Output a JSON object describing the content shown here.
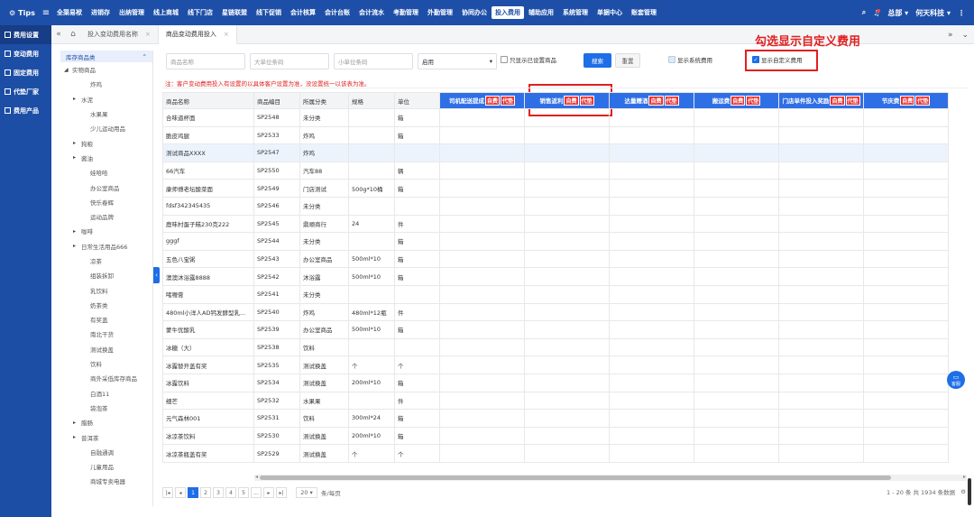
{
  "topbar": {
    "brand": "Tips",
    "items": [
      "全渠易袱",
      "进销存",
      "出纳管理",
      "线上商城",
      "线下门店",
      "星链联盟",
      "线下促销",
      "会计核算",
      "会计台账",
      "会计流水",
      "考勤管理",
      "外勤管理",
      "协同办公",
      "投入费用",
      "辅助应用",
      "系统管理",
      "单据中心",
      "账套管理"
    ],
    "active_index": 13,
    "user": "总部",
    "company": "何天科技"
  },
  "sidebar": {
    "items": [
      "费用设置",
      "变动费用",
      "固定费用",
      "代垫厂家",
      "费用产品"
    ],
    "active_index": 0
  },
  "tabs": {
    "items": [
      "投入变动费用名称",
      "商品变动费用投入"
    ],
    "active_index": 1
  },
  "tree": {
    "header": "库存商品类",
    "rows": [
      {
        "label": "实物商品",
        "indent": 0,
        "arrow": "◢"
      },
      {
        "label": "炸鸡",
        "indent": 2,
        "arrow": ""
      },
      {
        "label": "水泥",
        "indent": 1,
        "arrow": "▸"
      },
      {
        "label": "水果果",
        "indent": 2,
        "arrow": ""
      },
      {
        "label": "少儿运动用品",
        "indent": 2,
        "arrow": ""
      },
      {
        "label": "狗粮",
        "indent": 1,
        "arrow": "▸"
      },
      {
        "label": "酱油",
        "indent": 1,
        "arrow": "▸"
      },
      {
        "label": "娃哈哈",
        "indent": 2,
        "arrow": ""
      },
      {
        "label": "办公室商品",
        "indent": 2,
        "arrow": ""
      },
      {
        "label": "快乐春辉",
        "indent": 2,
        "arrow": ""
      },
      {
        "label": "运动品牌",
        "indent": 2,
        "arrow": ""
      },
      {
        "label": "咖啡",
        "indent": 1,
        "arrow": "▸"
      },
      {
        "label": "日常生活用品666",
        "indent": 1,
        "arrow": "▸"
      },
      {
        "label": "凉茶",
        "indent": 2,
        "arrow": ""
      },
      {
        "label": "组装拆卸",
        "indent": 2,
        "arrow": ""
      },
      {
        "label": "乳饮料",
        "indent": 2,
        "arrow": ""
      },
      {
        "label": "奶茶类",
        "indent": 2,
        "arrow": ""
      },
      {
        "label": "有奖盖",
        "indent": 2,
        "arrow": ""
      },
      {
        "label": "南北干货",
        "indent": 2,
        "arrow": ""
      },
      {
        "label": "测试换盖",
        "indent": 2,
        "arrow": ""
      },
      {
        "label": "饮料",
        "indent": 2,
        "arrow": ""
      },
      {
        "label": "商外采低库存商品",
        "indent": 2,
        "arrow": ""
      },
      {
        "label": "白酒11",
        "indent": 2,
        "arrow": ""
      },
      {
        "label": "袋泡茶",
        "indent": 2,
        "arrow": ""
      },
      {
        "label": "腊肠",
        "indent": 1,
        "arrow": "▸"
      },
      {
        "label": "普洱茶",
        "indent": 1,
        "arrow": "▸"
      },
      {
        "label": "自融通调",
        "indent": 2,
        "arrow": ""
      },
      {
        "label": "儿童用品",
        "indent": 2,
        "arrow": ""
      },
      {
        "label": "商城专卖电器",
        "indent": 2,
        "arrow": ""
      }
    ]
  },
  "filters": {
    "name_placeholder": "商品名称",
    "big_unit_placeholder": "大单位条码",
    "small_unit_placeholder": "小单位条码",
    "status_value": "启用",
    "only_set_label": "只显示已设置商品",
    "search_label": "搜索",
    "reset_label": "重置",
    "show_system_label": "显示系统费用",
    "show_custom_label": "显示自定义费用"
  },
  "annotation": "勾选显示自定义费用",
  "notice": "注：客户变动费用投入有设置的以具体客户设置为准，没设置统一以该表为准。",
  "table": {
    "columns": [
      "商品名称",
      "商品编目",
      "所属分类",
      "规格",
      "单位"
    ],
    "fee_columns": [
      "司机配送提成",
      "销售返利",
      "达量赠酒",
      "搬运费",
      "门店单件投入奖励",
      "节庆费"
    ],
    "tag_self": "自费",
    "tag_pay": "代垫",
    "rows": [
      [
        "合味道杯面",
        "SP2548",
        "未分类",
        "",
        "箱"
      ],
      [
        "脆皮鸡腿",
        "SP2533",
        "炸鸡",
        "",
        "箱"
      ],
      [
        "测试商品XXXX",
        "SP2547",
        "炸鸡",
        "",
        ""
      ],
      [
        "66汽车",
        "SP2550",
        "汽车88",
        "",
        "辆"
      ],
      [
        "康师傅老坛酸菜面",
        "SP2549",
        "门店测试",
        "500g*10桶",
        "箱"
      ],
      [
        "fdsf342345435",
        "SP2546",
        "未分类",
        "",
        ""
      ],
      [
        "鹿味村蛋子糕230克222",
        "SP2545",
        "鼎顺商行",
        "24",
        "件"
      ],
      [
        "gggf",
        "SP2544",
        "未分类",
        "",
        "箱"
      ],
      [
        "五色八宝粥",
        "SP2543",
        "办公室商品",
        "500ml*10",
        "箱"
      ],
      [
        "澳澳沐浴露8888",
        "SP2542",
        "沐浴露",
        "500ml*10",
        "箱"
      ],
      [
        "啫喱膏",
        "SP2541",
        "未分类",
        "",
        ""
      ],
      [
        "480ml小洋人AD钙发酵型乳...",
        "SP2540",
        "炸鸡",
        "480ml*12瓶",
        "件"
      ],
      [
        "蒙牛优酸乳",
        "SP2539",
        "办公室商品",
        "500ml*10",
        "箱"
      ],
      [
        "冰糖（大）",
        "SP2538",
        "饮料",
        "",
        ""
      ],
      [
        "冰露替开盖有奖",
        "SP2535",
        "测试换盖",
        "个",
        "个"
      ],
      [
        "冰露饮料",
        "SP2534",
        "测试换盖",
        "200ml*10",
        "箱"
      ],
      [
        "细芒",
        "SP2532",
        "水果果",
        "",
        "件"
      ],
      [
        "元气森林001",
        "SP2531",
        "饮料",
        "300ml*24",
        "箱"
      ],
      [
        "冰凉茶饮料",
        "SP2530",
        "测试换盖",
        "200ml*10",
        "箱"
      ],
      [
        "冰凉茶瓶盖有奖",
        "SP2529",
        "测试换盖",
        "个",
        "个"
      ]
    ],
    "highlight_row": 2
  },
  "pager": {
    "pages": [
      "1",
      "2",
      "3",
      "4",
      "5",
      "..."
    ],
    "page_size": "20",
    "unit": "条/每页",
    "summary": "1 - 20 条  共 1934 条数据"
  },
  "service_label": "客服"
}
